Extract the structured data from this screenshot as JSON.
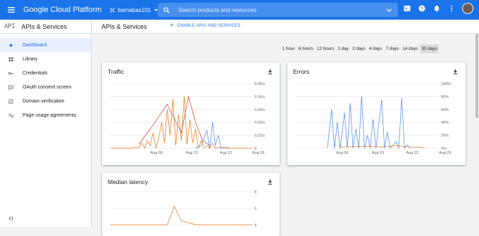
{
  "topbar": {
    "brand": "Google Cloud Platform",
    "project": "barnabas101",
    "search_placeholder": "Search products and resources",
    "icons": [
      "menu-icon",
      "project-dots-icon",
      "search-icon",
      "expand-icon",
      "cloud-shell-icon",
      "help-icon",
      "notifications-icon",
      "more-icon"
    ]
  },
  "sidebar": {
    "badge": "API",
    "title": "APIs & Services",
    "items": [
      {
        "label": "Dashboard",
        "icon": "dashboard-icon",
        "active": true
      },
      {
        "label": "Library",
        "icon": "library-icon",
        "active": false
      },
      {
        "label": "Credentials",
        "icon": "key-icon",
        "active": false
      },
      {
        "label": "OAuth consent screen",
        "icon": "consent-icon",
        "active": false
      },
      {
        "label": "Domain verification",
        "icon": "domain-icon",
        "active": false
      },
      {
        "label": "Page usage agreements",
        "icon": "agreements-icon",
        "active": false
      }
    ]
  },
  "header": {
    "title": "APIs & Services",
    "enable_label": "ENABLE APIS AND SERVICES"
  },
  "time_ranges": [
    "1 hour",
    "6 hours",
    "12 hours",
    "1 day",
    "2 days",
    "4 days",
    "7 days",
    "14 days",
    "30 days"
  ],
  "selected_range": "30 days",
  "colors": {
    "blue": "#4285f4",
    "orange": "#e8710a",
    "red": "#d93025",
    "accent": "#1a73e8"
  },
  "chart_data": [
    {
      "type": "line",
      "title": "Traffic",
      "x_ticks": [
        "Aug 08",
        "Aug 15",
        "Aug 22",
        "Aug 29"
      ],
      "y_ticks": [
        "0.05/s",
        "0.04/s",
        "0.03/s",
        "0.02/s",
        "0.01/s",
        "0"
      ],
      "ylim": [
        0,
        0.05
      ],
      "grid": true,
      "series": [
        {
          "color": "#e8710a",
          "x": [
            0,
            2,
            4,
            6,
            8,
            10,
            12,
            14,
            16,
            18,
            20,
            22,
            24,
            26,
            28,
            30,
            32,
            34,
            36,
            38,
            40,
            42,
            44,
            46,
            48,
            50,
            52,
            54,
            56,
            58,
            60,
            62,
            64,
            66,
            68,
            70,
            72,
            74,
            76,
            78,
            80,
            82,
            84,
            86,
            88,
            90,
            92,
            94,
            96,
            98,
            100
          ],
          "values": [
            0,
            0,
            0,
            0,
            0,
            0,
            0,
            0,
            0,
            0.001,
            0,
            0.004,
            0,
            0.006,
            0.002,
            0.012,
            0,
            0.008,
            0.02,
            0.004,
            0.03,
            0.01,
            0.038,
            0.002,
            0.026,
            0.006,
            0.04,
            0.003,
            0.022,
            0.004,
            0.015,
            0,
            0.006,
            0,
            0.002,
            0,
            0.004,
            0,
            0.001,
            0,
            0,
            0,
            0,
            0,
            0,
            0,
            0,
            0,
            0,
            0,
            0
          ]
        },
        {
          "color": "#d93025",
          "x": [
            20,
            30,
            40,
            50,
            55,
            60,
            65,
            70
          ],
          "values": [
            0.003,
            0.018,
            0.034,
            0.012,
            0.04,
            0.02,
            0.006,
            0.002
          ]
        },
        {
          "color": "#4285f4",
          "x": [
            60,
            64,
            68,
            70,
            72,
            74,
            76,
            78,
            80,
            84
          ],
          "values": [
            0,
            0.002,
            0.014,
            0,
            0.02,
            0.002,
            0.01,
            0,
            0.001,
            0
          ]
        }
      ]
    },
    {
      "type": "line",
      "title": "Errors",
      "x_ticks": [
        "Aug 08",
        "Aug 15",
        "Aug 22",
        "Aug 29"
      ],
      "y_ticks": [
        "100%",
        "80%",
        "60%",
        "40%",
        "20%",
        "0%"
      ],
      "ylim": [
        0,
        100
      ],
      "grid": true,
      "series": [
        {
          "color": "#4285f4",
          "x": [
            22,
            25,
            27,
            29,
            31,
            34,
            36,
            38,
            40,
            42,
            44,
            46,
            48,
            50,
            52,
            54,
            56,
            60,
            62,
            64,
            66,
            70,
            72,
            74,
            76,
            78,
            80
          ],
          "values": [
            0,
            60,
            0,
            40,
            0,
            55,
            0,
            70,
            0,
            30,
            0,
            80,
            0,
            20,
            0,
            45,
            0,
            75,
            0,
            25,
            0,
            10,
            0,
            78,
            0,
            5,
            0
          ]
        },
        {
          "color": "#e8710a",
          "x": [
            30,
            50,
            60,
            70,
            80,
            90
          ],
          "values": [
            2,
            3,
            2,
            4,
            2,
            1
          ]
        }
      ]
    },
    {
      "type": "line",
      "title": "Median latency",
      "y_ticks": [
        "8",
        "6",
        "4"
      ],
      "ylim": [
        4,
        8
      ],
      "grid": true,
      "series": [
        {
          "color": "#e8710a",
          "x": [
            0,
            10,
            20,
            30,
            40,
            45,
            50,
            60,
            70,
            80,
            90,
            100
          ],
          "values": [
            4,
            4,
            4,
            4,
            4,
            6.2,
            4.5,
            4,
            4,
            4,
            4,
            4
          ]
        }
      ]
    }
  ]
}
